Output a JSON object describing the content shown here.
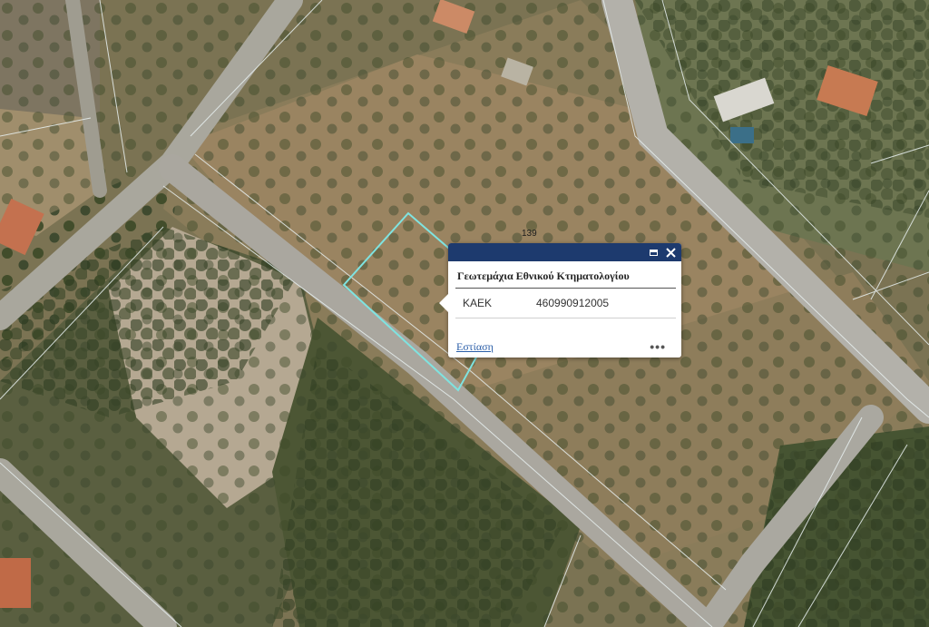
{
  "map": {
    "parcel_label": "139",
    "highlight_color": "#7fe3e0",
    "boundary_color": "#e8f0f0"
  },
  "popup": {
    "title": "Γεωτεμάχια Εθνικού Κτηματολογίου",
    "header_color": "#1d3a6e",
    "maximize_icon": "maximize-icon",
    "close_icon": "close-icon",
    "rows": [
      {
        "key": "ΚΑΕΚ",
        "value": "460990912005"
      }
    ],
    "zoom_link": "Εστίαση",
    "more_icon": "more-options-icon"
  }
}
